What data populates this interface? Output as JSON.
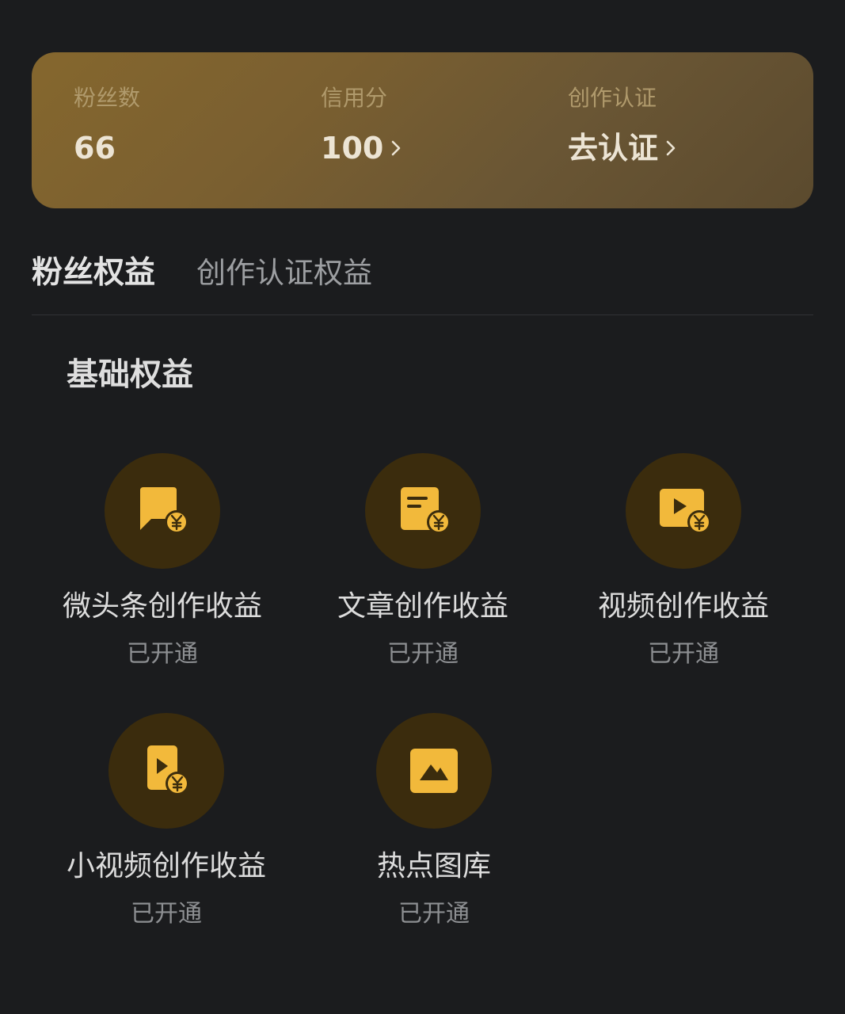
{
  "stats": {
    "fans": {
      "label": "粉丝数",
      "value": "66"
    },
    "credit": {
      "label": "信用分",
      "value": "100"
    },
    "certification": {
      "label": "创作认证",
      "value": "去认证"
    }
  },
  "tabs": [
    {
      "label": "粉丝权益",
      "active": true
    },
    {
      "label": "创作认证权益",
      "active": false
    }
  ],
  "section": {
    "title": "基础权益"
  },
  "benefits": [
    {
      "name": "微头条创作收益",
      "status": "已开通",
      "icon": "message-bubble-yuan-icon"
    },
    {
      "name": "文章创作收益",
      "status": "已开通",
      "icon": "article-yuan-icon"
    },
    {
      "name": "视频创作收益",
      "status": "已开通",
      "icon": "video-yuan-icon"
    },
    {
      "name": "小视频创作收益",
      "status": "已开通",
      "icon": "short-video-yuan-icon"
    },
    {
      "name": "热点图库",
      "status": "已开通",
      "icon": "image-gallery-icon"
    }
  ],
  "colors": {
    "background": "#1b1c1e",
    "card_gold": "#85672e",
    "icon_gold": "#f2b93b",
    "icon_circle": "#3b2c0d"
  }
}
